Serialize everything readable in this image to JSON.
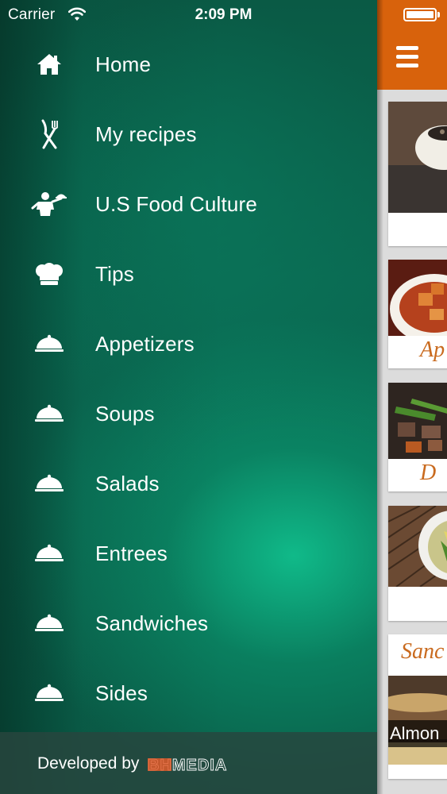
{
  "status_bar": {
    "carrier": "Carrier",
    "time": "2:09 PM"
  },
  "menu": {
    "items": [
      {
        "label": "Home",
        "icon": "home-icon"
      },
      {
        "label": "My recipes",
        "icon": "fork-knife-icon"
      },
      {
        "label": "U.S Food Culture",
        "icon": "waiter-icon"
      },
      {
        "label": "Tips",
        "icon": "chef-hat-icon"
      },
      {
        "label": "Appetizers",
        "icon": "cloche-icon"
      },
      {
        "label": "Soups",
        "icon": "cloche-icon"
      },
      {
        "label": "Salads",
        "icon": "cloche-icon"
      },
      {
        "label": "Entrees",
        "icon": "cloche-icon"
      },
      {
        "label": "Sandwiches",
        "icon": "cloche-icon"
      },
      {
        "label": "Sides",
        "icon": "cloche-icon"
      }
    ]
  },
  "footer": {
    "developed_by": "Developed by",
    "brand": "BHMEDIA"
  },
  "content": {
    "cards": [
      {
        "label": ""
      },
      {
        "label": "Ap"
      },
      {
        "label": "D"
      },
      {
        "label": ""
      },
      {
        "label": "Sanc",
        "caption": "Almon"
      }
    ]
  },
  "colors": {
    "accent_orange": "#d8620c",
    "drawer_green": "#0a6a52",
    "card_label": "#c96a1e"
  }
}
